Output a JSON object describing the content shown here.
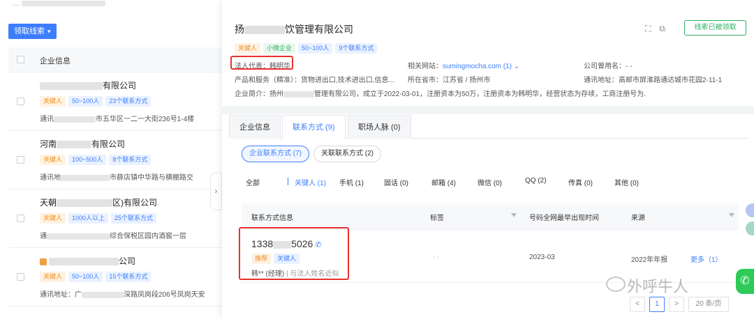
{
  "left": {
    "top_strip": "…",
    "claim_button": "领取线索",
    "header_label": "企业信息",
    "rows": [
      {
        "name_suffix": "有限公司",
        "tags": [
          "关键人",
          "50~100人",
          "23个联系方式"
        ],
        "addr_prefix": "通讯",
        "addr_suffix": "市五华区一二一大街236号1-4楼"
      },
      {
        "name_prefix": "河南",
        "name_suffix": "有限公司",
        "tags": [
          "关键人",
          "100~500人",
          "8个联系方式"
        ],
        "addr_prefix": "通讯地",
        "addr_suffix": "市薛店镇中华路与横棚路交"
      },
      {
        "name_prefix": "天朝",
        "name_suffix": "区)有限公司",
        "tags": [
          "关键人",
          "1000人以上",
          "25个联系方式"
        ],
        "addr_prefix": "通",
        "addr_suffix": "综合保税区园内酒窖一层"
      },
      {
        "name_suffix": "公司",
        "tags": [
          "关键人",
          "50~100人",
          "15个联系方式"
        ],
        "addr_prefix": "通讯地址：广",
        "addr_suffix": "深路凤岗段206号凤岗天安"
      }
    ]
  },
  "detail": {
    "title_prefix": "扬",
    "title_suffix": "饮管理有限公司",
    "claimed_button": "线索已被领取",
    "tags": [
      "关键人",
      "小微企业",
      "50~100人",
      "9个联系方式"
    ],
    "legal_rep": "法人代表：韩明华",
    "website_label": "相关网站：",
    "website_value": "sumingmocha.com (1)",
    "alias": "公司曾用名：- -",
    "products": "产品和服务（精准）：货物进出口,技术进出口,信息...",
    "location": "所在省市：江苏省 / 扬州市",
    "address": "通讯地址：高邮市屏淮路通达城市花园2-11-1",
    "intro_prefix": "企业简介：扬州",
    "intro_suffix": "管理有限公司，成立于2022-03-01，注册资本为50万，注册资本为韩明华，经营状态为存续，工商注册号为..."
  },
  "tabs": [
    "企业信息",
    "联系方式 (9)",
    "职场人脉 (0)"
  ],
  "subtabs": [
    "企业联系方式 (7)",
    "关联联系方式 (2)"
  ],
  "filters": [
    "全部",
    "关键人 (1)",
    "手机 (1)",
    "固话 (0)",
    "邮箱 (4)",
    "微信 (0)",
    "QQ (2)",
    "传真 (0)",
    "其他 (0)"
  ],
  "table": {
    "headers": [
      "联系方式信息",
      "标签",
      "号码全网最早出现时间",
      "来源"
    ],
    "row": {
      "phone_prefix": "1338",
      "phone_suffix": "5026",
      "tags": [
        "推荐",
        "关键人"
      ],
      "note_name": "韩** (经理)",
      "note_extra": "| 与法人姓名近似",
      "label": "- -",
      "first_seen": "2023-03",
      "source": "2022年年报",
      "more": "更多（1）"
    }
  },
  "pager": {
    "prev": "<",
    "page": "1",
    "next": ">",
    "size": "20 条/页"
  },
  "watermark": "外呼牛人",
  "colors": {
    "primary": "#3d7eff",
    "green": "#2fae60",
    "orange": "#f08c16",
    "highlight": "#e8312c"
  }
}
